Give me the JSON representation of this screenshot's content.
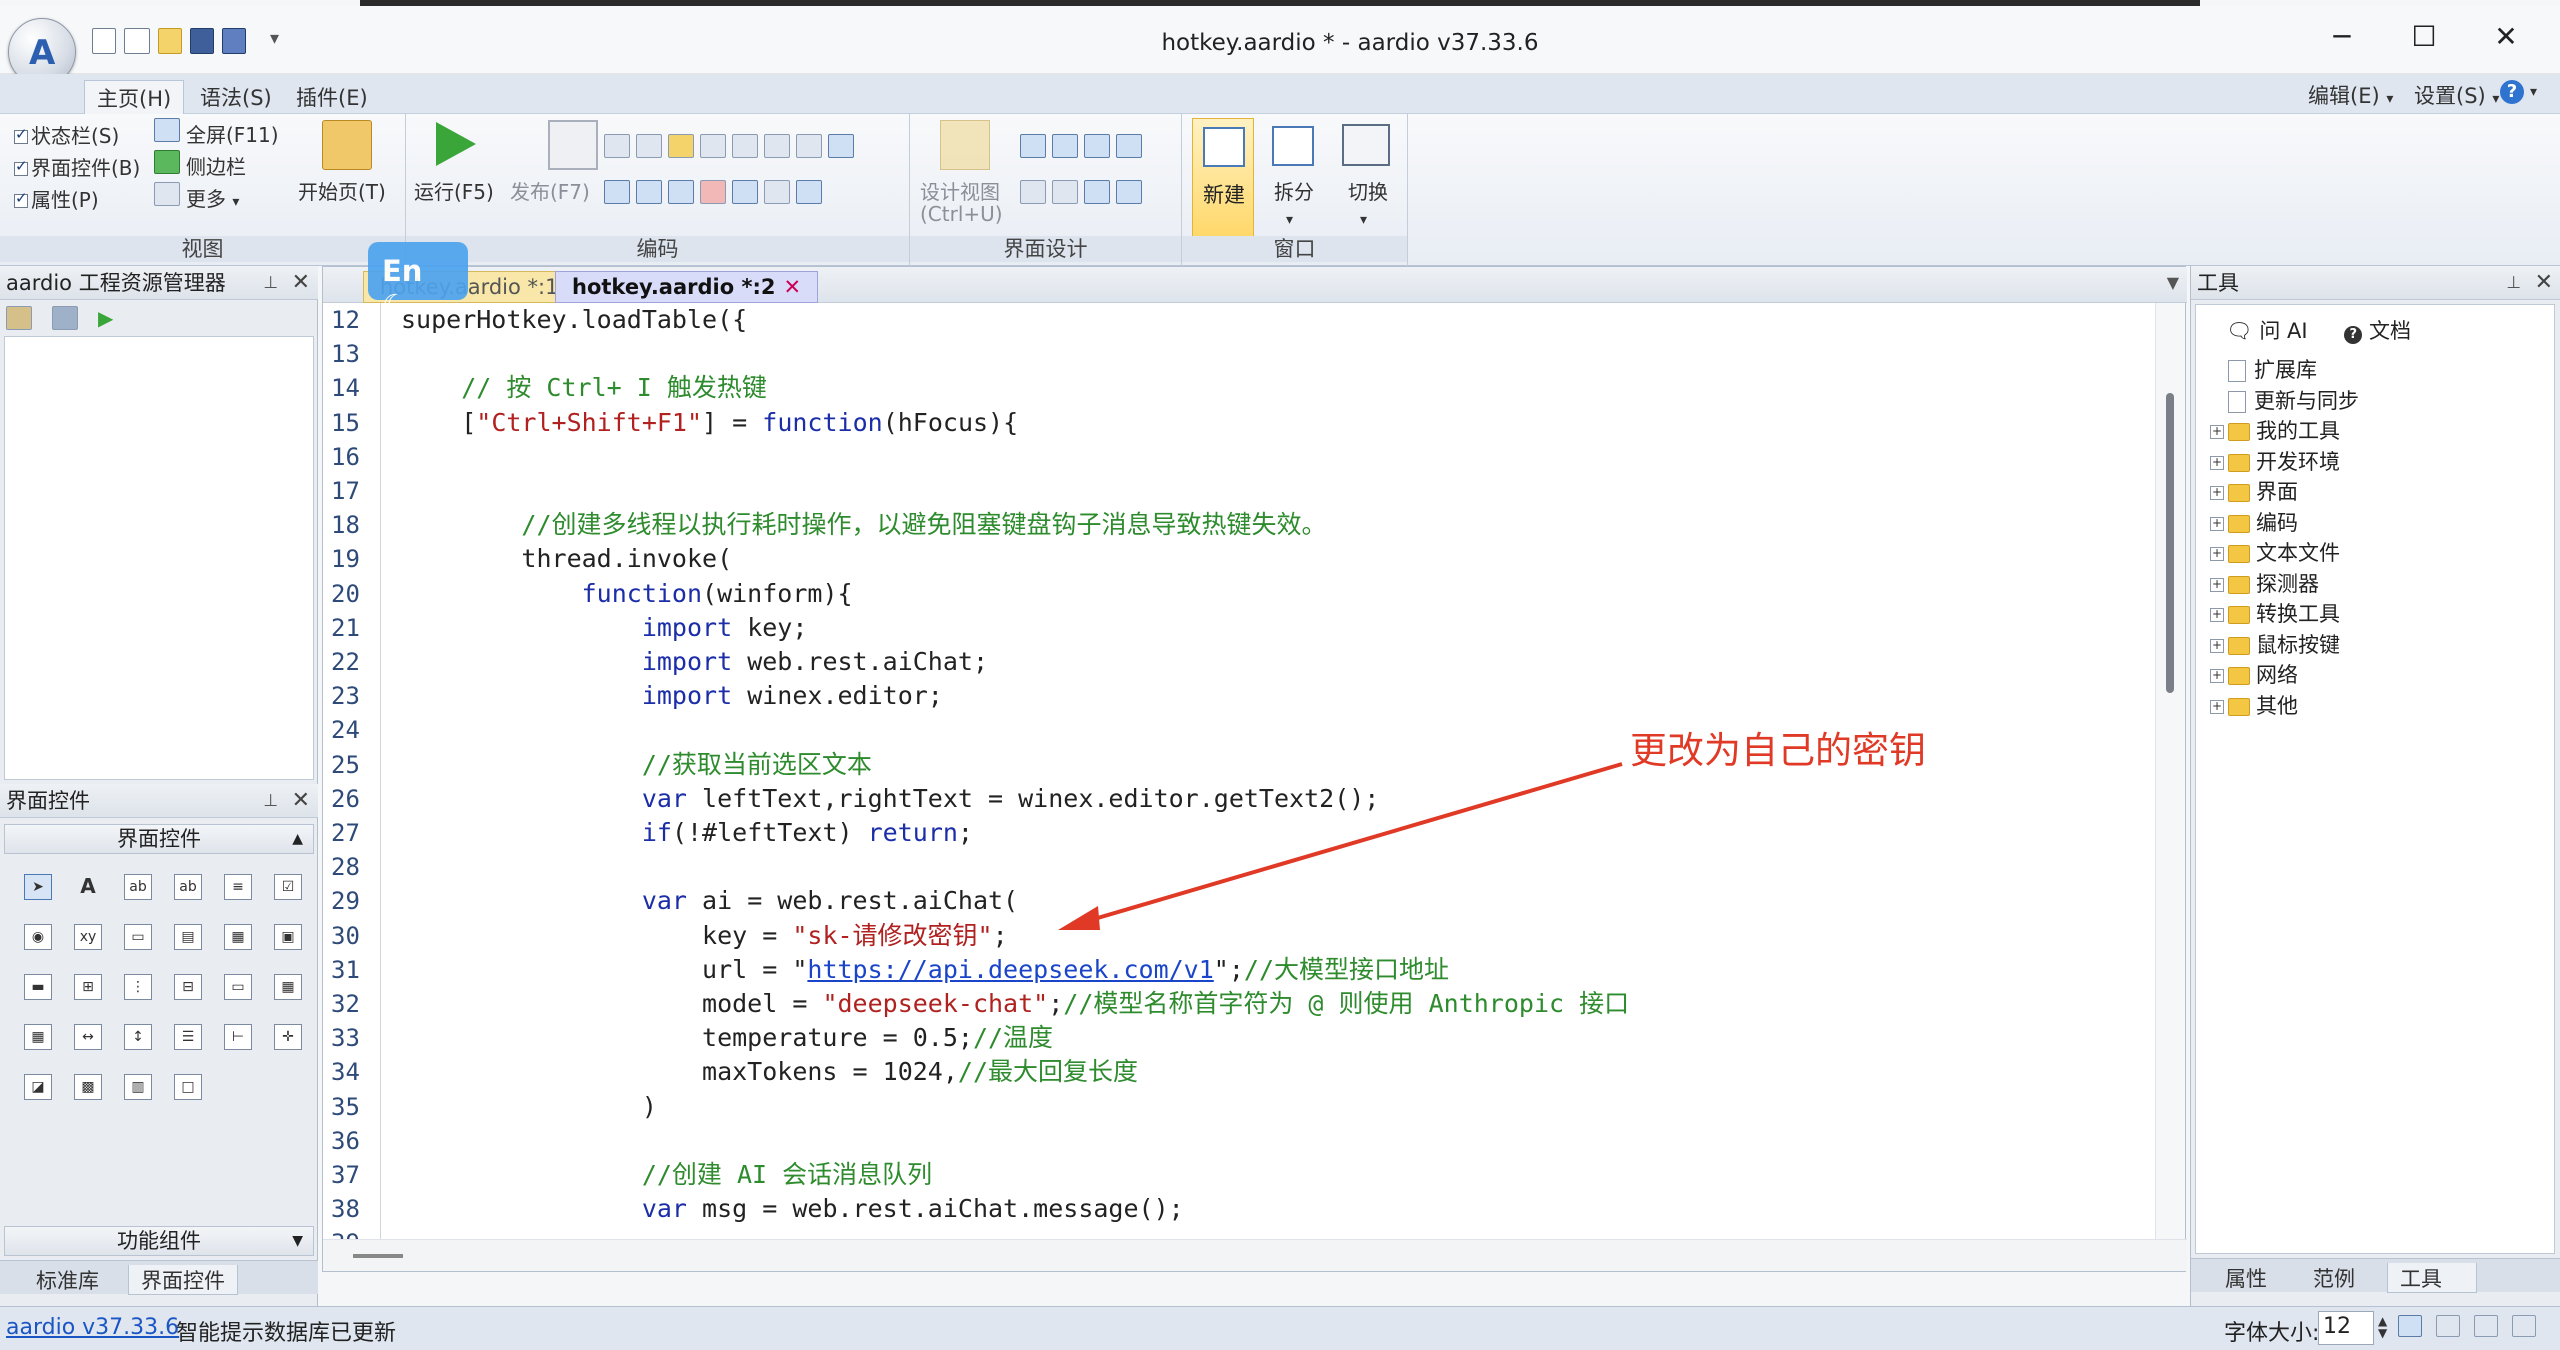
{
  "window": {
    "title": "hotkey.aardio * - aardio v37.33.6",
    "minimize": "─",
    "maximize": "☐",
    "close": "✕"
  },
  "menu": {
    "tabs": [
      "主页(H)",
      "语法(S)",
      "插件(E)"
    ],
    "right": [
      "编辑(E)",
      "设置(S)"
    ]
  },
  "ribbon": {
    "view": {
      "label": "视图",
      "statusbar": "状态栏(S)",
      "controls": "界面控件(B)",
      "props": "属性(P)",
      "fullscreen": "全屏(F11)",
      "sidebar": "侧边栏",
      "more": "更多",
      "start": "开始页(T)"
    },
    "code": {
      "label": "编码",
      "run": "运行(F5)",
      "publish": "发布(F7)"
    },
    "design": {
      "label": "界面设计",
      "design_view": "设计视图",
      "design_view_key": "(Ctrl+U)"
    },
    "window": {
      "label": "窗口",
      "new": "新建",
      "split": "拆分",
      "switch": "切换"
    }
  },
  "left_panel": {
    "title": "aardio 工程资源管理器",
    "controls_title": "界面控件",
    "controls_header": "界面控件",
    "func_header": "功能组件",
    "tabs": [
      "标准库",
      "界面控件"
    ]
  },
  "ime": {
    "label": "En ☾"
  },
  "editor": {
    "tabs": [
      "hotkey.aardio *:1",
      "hotkey.aardio *:2"
    ],
    "active_tab": 1,
    "lines": [
      {
        "n": "12",
        "parts": [
          [
            "",
            "superHotkey.loadTable({"
          ]
        ]
      },
      {
        "n": "13",
        "parts": []
      },
      {
        "n": "14",
        "parts": [
          [
            "cm",
            "    // 按 Ctrl+ I 触发热键"
          ]
        ]
      },
      {
        "n": "15",
        "parts": [
          [
            "",
            "    ["
          ],
          [
            "str",
            "\"Ctrl+Shift+F1\""
          ],
          [
            "",
            "] = "
          ],
          [
            "kw",
            "function"
          ],
          [
            "",
            "(hFocus){"
          ]
        ]
      },
      {
        "n": "16",
        "parts": []
      },
      {
        "n": "17",
        "parts": []
      },
      {
        "n": "18",
        "parts": [
          [
            "cm",
            "        //创建多线程以执行耗时操作，以避免阻塞键盘钩子消息导致热键失效。"
          ]
        ]
      },
      {
        "n": "19",
        "parts": [
          [
            "",
            "        thread.invoke("
          ]
        ]
      },
      {
        "n": "20",
        "parts": [
          [
            "kw",
            "            function"
          ],
          [
            "",
            "(winform){"
          ]
        ]
      },
      {
        "n": "21",
        "parts": [
          [
            "kw",
            "                import"
          ],
          [
            "",
            " key;"
          ]
        ]
      },
      {
        "n": "22",
        "parts": [
          [
            "kw",
            "                import"
          ],
          [
            "",
            " web.rest.aiChat;"
          ]
        ]
      },
      {
        "n": "23",
        "parts": [
          [
            "kw",
            "                import"
          ],
          [
            "",
            " winex.editor;"
          ]
        ]
      },
      {
        "n": "24",
        "parts": []
      },
      {
        "n": "25",
        "parts": [
          [
            "cm",
            "                //获取当前选区文本"
          ]
        ]
      },
      {
        "n": "26",
        "parts": [
          [
            "kw",
            "                var"
          ],
          [
            "",
            " leftText,rightText = winex.editor.getText2();"
          ]
        ]
      },
      {
        "n": "27",
        "parts": [
          [
            "kw",
            "                if"
          ],
          [
            "",
            "(!#leftText) "
          ],
          [
            "kw",
            "return"
          ],
          [
            "",
            ";"
          ]
        ]
      },
      {
        "n": "28",
        "parts": []
      },
      {
        "n": "29",
        "parts": [
          [
            "kw",
            "                var"
          ],
          [
            "",
            " ai = web.rest.aiChat("
          ]
        ]
      },
      {
        "n": "30",
        "parts": [
          [
            "",
            "                    key = "
          ],
          [
            "str",
            "\"sk-请修改密钥\""
          ],
          [
            "",
            ";"
          ]
        ]
      },
      {
        "n": "31",
        "parts": [
          [
            "",
            "                    url = \""
          ],
          [
            "url",
            "https://api.deepseek.com/v1"
          ],
          [
            "",
            "\";"
          ],
          [
            "cm",
            "//大模型接口地址"
          ]
        ]
      },
      {
        "n": "32",
        "parts": [
          [
            "",
            "                    model = "
          ],
          [
            "str",
            "\"deepseek-chat\""
          ],
          [
            "",
            ";"
          ],
          [
            "cm",
            "//模型名称首字符为 @ 则使用 Anthropic 接口"
          ]
        ]
      },
      {
        "n": "33",
        "parts": [
          [
            "",
            "                    temperature = 0.5;"
          ],
          [
            "cm",
            "//温度"
          ]
        ]
      },
      {
        "n": "34",
        "parts": [
          [
            "",
            "                    maxTokens = 1024,"
          ],
          [
            "cm",
            "//最大回复长度"
          ]
        ]
      },
      {
        "n": "35",
        "parts": [
          [
            "",
            "                )"
          ]
        ]
      },
      {
        "n": "36",
        "parts": []
      },
      {
        "n": "37",
        "parts": [
          [
            "cm",
            "                //创建 AI 会话消息队列"
          ]
        ]
      },
      {
        "n": "38",
        "parts": [
          [
            "kw",
            "                var"
          ],
          [
            "",
            " msg = web.rest.aiChat.message();"
          ]
        ]
      },
      {
        "n": "39",
        "parts": []
      }
    ]
  },
  "annotation": {
    "text": "更改为自己的密钥",
    "color": "#e03a26"
  },
  "right_panel": {
    "title": "工具",
    "ask_ai": "问 AI",
    "docs": "文档",
    "pages": [
      "扩展库",
      "更新与同步"
    ],
    "folders": [
      "我的工具",
      "开发环境",
      "界面",
      "编码",
      "文本文件",
      "探测器",
      "转换工具",
      "鼠标按键",
      "网络",
      "其他"
    ],
    "tabs": [
      "属性",
      "范例",
      "工具"
    ]
  },
  "statusbar": {
    "version_link": "aardio v37.33.6",
    "message": "智能提示数据库已更新",
    "font_size_label": "字体大小:",
    "font_size_value": "12"
  }
}
